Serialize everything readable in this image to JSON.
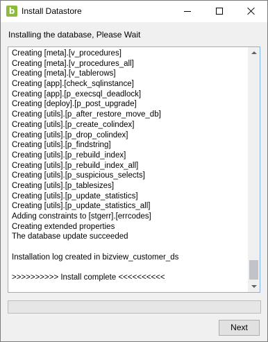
{
  "window": {
    "title": "Install Datastore",
    "icon": "datastore-b-icon",
    "icon_letter": "b",
    "accent_color": "#8cba3c"
  },
  "status_label": "Installing the database, Please Wait",
  "log": {
    "lines": [
      "Creating [meta].[v_procedures]",
      "Creating [meta].[v_procedures_all]",
      "Creating [meta].[v_tablerows]",
      "Creating [app].[check_sqlinstance]",
      "Creating [app].[p_execsql_deadlock]",
      "Creating [deploy].[p_post_upgrade]",
      "Creating [utils].[p_after_restore_move_db]",
      "Creating [utils].[p_create_colindex]",
      "Creating [utils].[p_drop_colindex]",
      "Creating [utils].[p_findstring]",
      "Creating [utils].[p_rebuild_index]",
      "Creating [utils].[p_rebuild_index_all]",
      "Creating [utils].[p_suspicious_selects]",
      "Creating [utils].[p_tablesizes]",
      "Creating [utils].[p_update_statistics]",
      "Creating [utils].[p_update_statistics_all]",
      "Adding constraints to [stgerr].[errcodes]",
      "Creating extended properties",
      "The database update succeeded",
      "",
      "Installation log created in bizview_customer_ds",
      "",
      ">>>>>>>>>> Install complete <<<<<<<<<<"
    ]
  },
  "progress": {
    "value": 0,
    "color": "#06b025"
  },
  "buttons": {
    "next_label": "Next"
  }
}
